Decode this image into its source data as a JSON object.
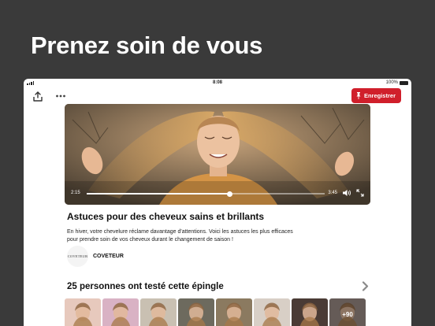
{
  "headline": "Prenez soin de vous",
  "status_bar": {
    "time": "8:08",
    "battery": "100%"
  },
  "toolbar": {
    "save_label": "Enregistrer"
  },
  "video": {
    "current_time": "2:15",
    "total_time": "3:45",
    "progress": 0.6
  },
  "pin": {
    "title": "Astuces pour des cheveux sains et brillants",
    "description": "En hiver, votre chevelure réclame davantage d'attentions. Voici les astuces les plus efficaces pour prendre soin de vos cheveux durant le changement de saison !",
    "creator_logo": "COVETEUR",
    "creator_name": "COVETEUR"
  },
  "tried": {
    "heading": "25 personnes ont testé cette épingle",
    "more_count": "+90",
    "thumb_colors": [
      "#e7c9bd",
      "#d9b2c4",
      "#c9c0b2",
      "#6d6a5e",
      "#8b7a60",
      "#d8cfc6",
      "#4a3b35",
      "#9c8d86"
    ]
  },
  "colors": {
    "background": "#3a3a3a",
    "accent": "#d01f2b"
  }
}
